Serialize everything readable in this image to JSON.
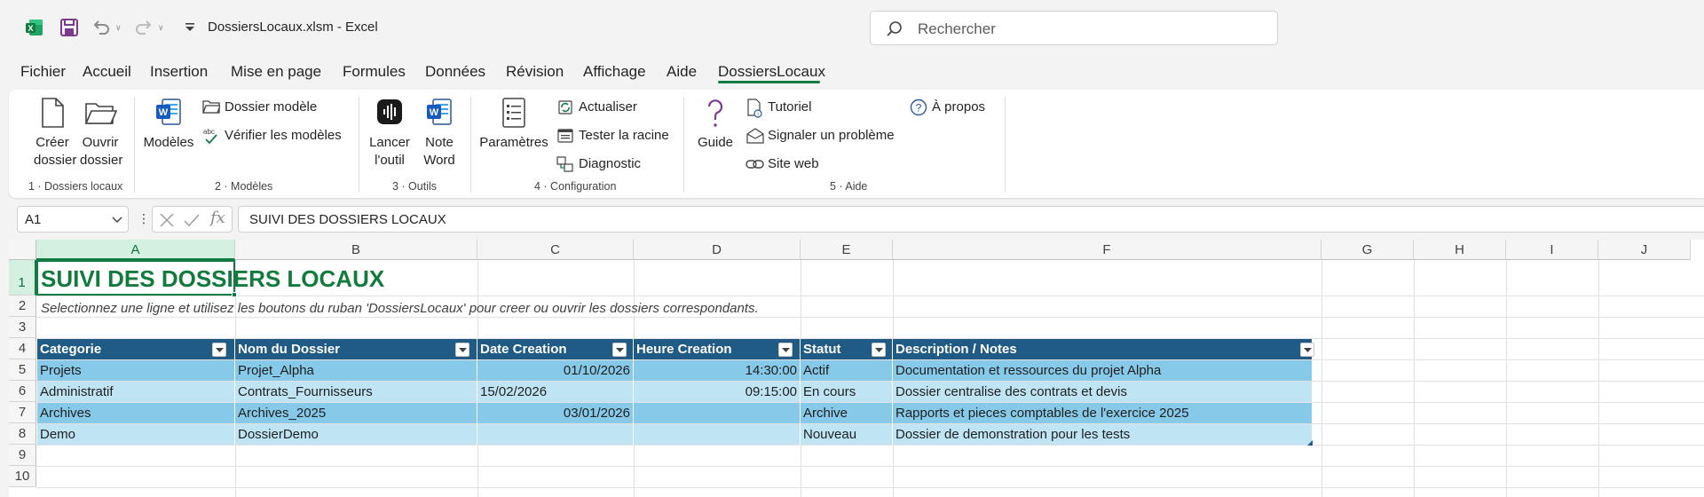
{
  "window": {
    "title": "DossiersLocaux.xlsm  -  Excel"
  },
  "search": {
    "placeholder": "Rechercher"
  },
  "tabs": [
    {
      "label": "Fichier"
    },
    {
      "label": "Accueil"
    },
    {
      "label": "Insertion"
    },
    {
      "label": "Mise en page"
    },
    {
      "label": "Formules"
    },
    {
      "label": "Données"
    },
    {
      "label": "Révision"
    },
    {
      "label": "Affichage"
    },
    {
      "label": "Aide"
    },
    {
      "label": "DossiersLocaux"
    }
  ],
  "ribbon": {
    "groups": {
      "g1": "1 · Dossiers locaux",
      "g2": "2 · Modèles",
      "g3": "3 · Outils",
      "g4": "4 · Configuration",
      "g5": "5 · Aide"
    },
    "creer": [
      "Créer",
      "dossier"
    ],
    "ouvrir": [
      "Ouvrir",
      "dossier"
    ],
    "modeles": "Modèles",
    "dossier_modele": "Dossier modèle",
    "verifier": "Vérifier les modèles",
    "lancer": [
      "Lancer",
      "l'outil"
    ],
    "note": [
      "Note",
      "Word"
    ],
    "parametres": "Paramètres",
    "actualiser": "Actualiser",
    "tester": "Tester la racine",
    "diagnostic": "Diagnostic",
    "guide": "Guide",
    "tutoriel": "Tutoriel",
    "signaler": "Signaler un problème",
    "site": "Site web",
    "apropos": "À propos"
  },
  "formula_bar": {
    "cell_ref": "A1",
    "content": "SUIVI DES DOSSIERS LOCAUX"
  },
  "columns": [
    "A",
    "B",
    "C",
    "D",
    "E",
    "F",
    "G",
    "H",
    "I",
    "J"
  ],
  "rows": [
    "1",
    "2",
    "3",
    "4",
    "5",
    "6",
    "7",
    "8",
    "9",
    "10"
  ],
  "sheet": {
    "title": "SUIVI DES DOSSIERS LOCAUX",
    "subtitle": "Selectionnez une ligne et utilisez les boutons du ruban 'DossiersLocaux' pour creer ou ouvrir les dossiers correspondants.",
    "headers": [
      "Categorie",
      "Nom du Dossier",
      "Date Creation",
      "Heure Creation",
      "Statut",
      "Description / Notes"
    ],
    "records": [
      [
        "Projets",
        "Projet_Alpha",
        "01/10/2026",
        "14:30:00",
        "Actif",
        "Documentation et ressources du projet Alpha"
      ],
      [
        "Administratif",
        "Contrats_Fournisseurs",
        "15/02/2026",
        "09:15:00",
        "En cours",
        "Dossier centralise des contrats et devis"
      ],
      [
        "Archives",
        "Archives_2025",
        "03/01/2026",
        "",
        "Archive",
        "Rapports et pieces comptables de l'exercice 2025"
      ],
      [
        "Demo",
        "DossierDemo",
        "",
        "",
        "Nouveau",
        "Dossier de demonstration pour les tests"
      ]
    ]
  },
  "colors": {
    "accent": "#107c41",
    "table_header": "#1f5b85",
    "band_dark": "#86c9e8",
    "band_light": "#bfe5f5",
    "title_green": "#137a3e"
  }
}
